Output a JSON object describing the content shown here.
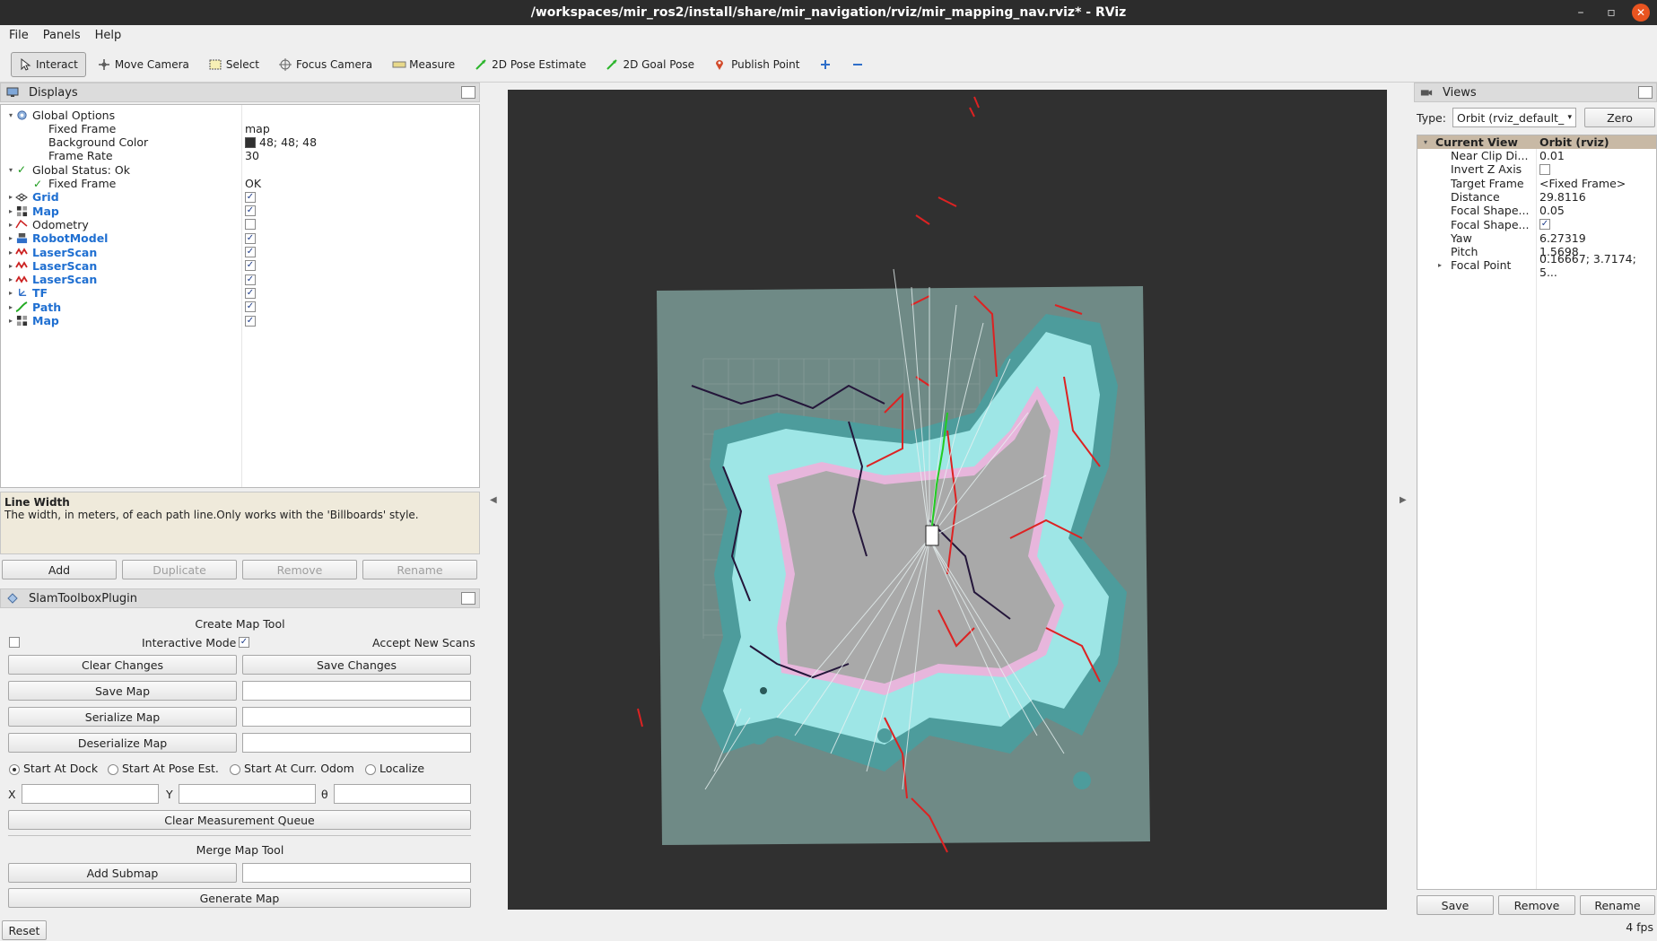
{
  "window": {
    "title": "/workspaces/mir_ros2/install/share/mir_navigation/rviz/mir_mapping_nav.rviz* - RViz",
    "controls": [
      "–",
      "▫",
      "✕"
    ]
  },
  "menu": [
    "File",
    "Panels",
    "Help"
  ],
  "toolbar": [
    {
      "label": "Interact",
      "icon": "cursor-icon",
      "active": true
    },
    {
      "label": "Move Camera",
      "icon": "move-icon"
    },
    {
      "label": "Select",
      "icon": "select-icon"
    },
    {
      "label": "Focus Camera",
      "icon": "target-icon"
    },
    {
      "label": "Measure",
      "icon": "ruler-icon"
    },
    {
      "label": "2D Pose Estimate",
      "icon": "arrow-green-icon"
    },
    {
      "label": "2D Goal Pose",
      "icon": "arrow-green-icon"
    },
    {
      "label": "Publish Point",
      "icon": "pin-icon"
    },
    {
      "label": "",
      "icon": "plus-icon"
    },
    {
      "label": "",
      "icon": "minus-icon"
    }
  ],
  "displays": {
    "title": "Displays",
    "rows": [
      {
        "indent": 0,
        "arrow": "▾",
        "icon": "gear",
        "name": "Global Options",
        "value": "",
        "style": "normal"
      },
      {
        "indent": 1,
        "arrow": "",
        "icon": "",
        "name": "Fixed Frame",
        "value": "map",
        "style": "normal"
      },
      {
        "indent": 1,
        "arrow": "",
        "icon": "",
        "name": "Background Color",
        "value": "48; 48; 48",
        "swatch": "#303030",
        "style": "normal"
      },
      {
        "indent": 1,
        "arrow": "",
        "icon": "",
        "name": "Frame Rate",
        "value": "30",
        "style": "normal"
      },
      {
        "indent": 0,
        "arrow": "▾",
        "icon": "check",
        "name": "Global Status: Ok",
        "value": "",
        "style": "normal"
      },
      {
        "indent": 1,
        "arrow": "",
        "icon": "check",
        "name": "Fixed Frame",
        "value": "OK",
        "style": "normal"
      },
      {
        "indent": 0,
        "arrow": "▸",
        "icon": "grid",
        "name": "Grid",
        "check": true,
        "style": "bold"
      },
      {
        "indent": 0,
        "arrow": "▸",
        "icon": "map",
        "name": "Map",
        "check": true,
        "style": "bold"
      },
      {
        "indent": 0,
        "arrow": "▸",
        "icon": "odom",
        "name": "Odometry",
        "check": false,
        "style": "normal"
      },
      {
        "indent": 0,
        "arrow": "▸",
        "icon": "robot",
        "name": "RobotModel",
        "check": true,
        "style": "bold"
      },
      {
        "indent": 0,
        "arrow": "▸",
        "icon": "laser",
        "name": "LaserScan",
        "check": true,
        "style": "bold"
      },
      {
        "indent": 0,
        "arrow": "▸",
        "icon": "laser",
        "name": "LaserScan",
        "check": true,
        "style": "bold"
      },
      {
        "indent": 0,
        "arrow": "▸",
        "icon": "laser",
        "name": "LaserScan",
        "check": true,
        "style": "bold"
      },
      {
        "indent": 0,
        "arrow": "▸",
        "icon": "tf",
        "name": "TF",
        "check": true,
        "style": "bold"
      },
      {
        "indent": 0,
        "arrow": "▸",
        "icon": "path",
        "name": "Path",
        "check": true,
        "style": "bold"
      },
      {
        "indent": 0,
        "arrow": "▸",
        "icon": "map",
        "name": "Map",
        "check": true,
        "style": "bold"
      }
    ]
  },
  "description": {
    "title": "Line Width",
    "text": "The width, in meters, of each path line.Only works with the 'Billboards' style."
  },
  "display_buttons": [
    "Add",
    "Duplicate",
    "Remove",
    "Rename"
  ],
  "slam": {
    "title": "SlamToolboxPlugin",
    "create_map_tool": "Create Map Tool",
    "interactive_mode": "Interactive Mode",
    "accept_new_scans": "Accept New Scans",
    "clear_changes": "Clear Changes",
    "save_changes": "Save Changes",
    "save_map": "Save Map",
    "serialize_map": "Serialize Map",
    "deserialize_map": "Deserialize Map",
    "radios": [
      "Start At Dock",
      "Start At Pose Est.",
      "Start At Curr. Odom",
      "Localize"
    ],
    "x_label": "X",
    "y_label": "Y",
    "theta_label": "θ",
    "clear_queue": "Clear Measurement Queue",
    "merge_map_tool": "Merge Map Tool",
    "add_submap": "Add Submap",
    "generate_map": "Generate Map"
  },
  "views": {
    "title": "Views",
    "type_label": "Type:",
    "type_value": "Orbit (rviz_default_",
    "zero": "Zero",
    "header": {
      "name": "Current View",
      "value": "Orbit (rviz)"
    },
    "rows": [
      {
        "name": "Near Clip Di...",
        "value": "0.01"
      },
      {
        "name": "Invert Z Axis",
        "value": "",
        "check": false
      },
      {
        "name": "Target Frame",
        "value": "<Fixed Frame>"
      },
      {
        "name": "Distance",
        "value": "29.8116"
      },
      {
        "name": "Focal Shape...",
        "value": "0.05"
      },
      {
        "name": "Focal Shape...",
        "value": "",
        "check": true
      },
      {
        "name": "Yaw",
        "value": "6.27319"
      },
      {
        "name": "Pitch",
        "value": "1.5698"
      },
      {
        "name": "Focal Point",
        "value": "0.16667; 3.7174; 5...",
        "arrow": "▸"
      }
    ],
    "buttons": [
      "Save",
      "Remove",
      "Rename"
    ]
  },
  "status": {
    "reset": "Reset",
    "fps": "4 fps"
  },
  "colors": {
    "viewport_bg": "#303030",
    "map_unknown": "#6f8a86",
    "costmap_cyan": "#9ee6e6",
    "costmap_teal": "#4d9c9c",
    "free_space": "#a9a9a9",
    "inflation_pink": "#e7b6dc",
    "path_green": "#22cc22",
    "scan_red": "#dd2222"
  }
}
